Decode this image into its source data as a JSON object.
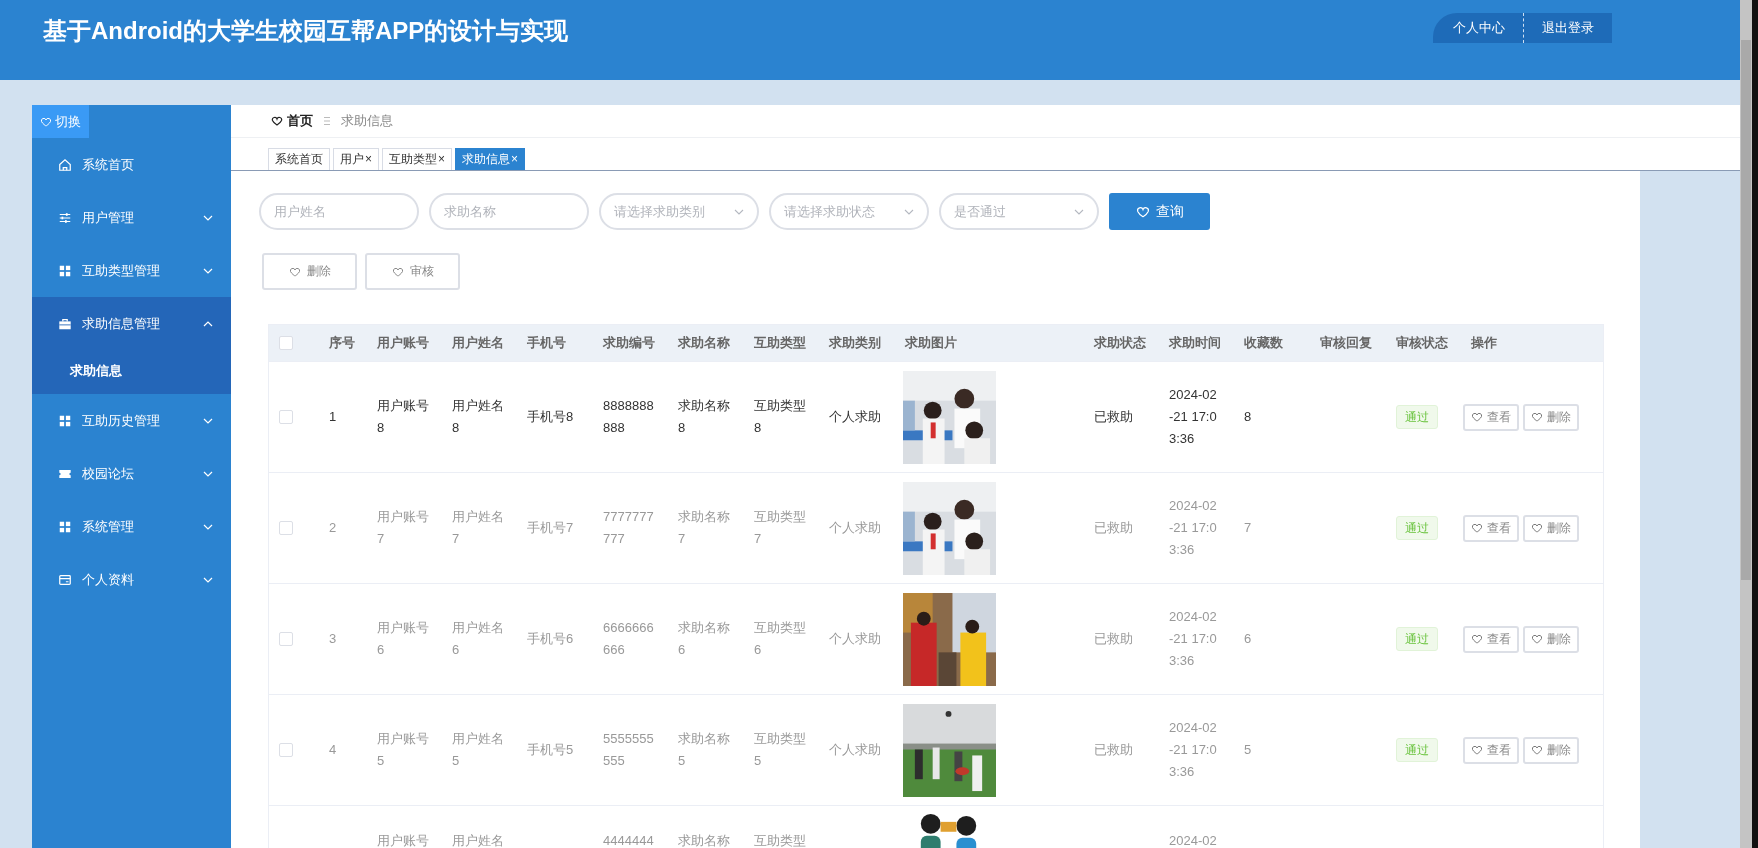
{
  "header": {
    "title": "基于Android的大学生校园互帮APP的设计与实现",
    "links": [
      {
        "label": "个人中心"
      },
      {
        "label": "退出登录"
      }
    ]
  },
  "sidebar": {
    "toggle": "切换",
    "items": [
      {
        "label": "系统首页",
        "collapsible": false,
        "expanded": false
      },
      {
        "label": "用户管理",
        "collapsible": true,
        "expanded": false
      },
      {
        "label": "互助类型管理",
        "collapsible": true,
        "expanded": false
      },
      {
        "label": "求助信息管理",
        "collapsible": true,
        "expanded": true,
        "children": [
          {
            "label": "求助信息",
            "selected": true
          }
        ]
      },
      {
        "label": "互助历史管理",
        "collapsible": true,
        "expanded": false
      },
      {
        "label": "校园论坛",
        "collapsible": true,
        "expanded": false
      },
      {
        "label": "系统管理",
        "collapsible": true,
        "expanded": false
      },
      {
        "label": "个人资料",
        "collapsible": true,
        "expanded": false
      }
    ]
  },
  "breadcrumb": {
    "home": "首页",
    "current": "求助信息"
  },
  "tabs": [
    {
      "label": "系统首页",
      "selected": false
    },
    {
      "label": "用户",
      "close": "×",
      "selected": false
    },
    {
      "label": "互助类型",
      "close": "×",
      "selected": false
    },
    {
      "label": "求助信息",
      "close": "×",
      "selected": true
    }
  ],
  "filters": [
    {
      "kind": "text",
      "placeholder": "用户姓名"
    },
    {
      "kind": "text",
      "placeholder": "求助名称"
    },
    {
      "kind": "select",
      "placeholder": "请选择求助类别"
    },
    {
      "kind": "select",
      "placeholder": "请选择求助状态"
    },
    {
      "kind": "select",
      "placeholder": "是否通过"
    }
  ],
  "search_button": "查询",
  "actions": [
    {
      "label": "删除"
    },
    {
      "label": "审核"
    }
  ],
  "table": {
    "select_all": {
      "checked": false
    },
    "columns": [
      "序号",
      "用户账号",
      "用户姓名",
      "手机号",
      "求助编号",
      "求助名称",
      "互助类型",
      "求助类别",
      "求助图片",
      "求助状态",
      "求助时间",
      "收藏数",
      "审核回复",
      "审核状态",
      "操作"
    ],
    "rows": [
      {
        "checked": false,
        "highlighted": true,
        "index": "1",
        "account": "用户账号8",
        "name": "用户姓名8",
        "phone": "手机号8",
        "code": "8888888888",
        "title": "求助名称8",
        "type": "互助类型8",
        "category": "个人求助",
        "status": "已救助",
        "time": "2024-02-21 17:03:36",
        "favorites": "8",
        "audit": "通过",
        "buttons": [
          "查看",
          "删除"
        ]
      },
      {
        "checked": false,
        "highlighted": false,
        "index": "2",
        "account": "用户账号7",
        "name": "用户姓名7",
        "phone": "手机号7",
        "code": "7777777777",
        "title": "求助名称7",
        "type": "互助类型7",
        "category": "个人求助",
        "status": "已救助",
        "time": "2024-02-21 17:03:36",
        "favorites": "7",
        "audit": "通过",
        "buttons": [
          "查看",
          "删除"
        ]
      },
      {
        "checked": false,
        "highlighted": false,
        "index": "3",
        "account": "用户账号6",
        "name": "用户姓名6",
        "phone": "手机号6",
        "code": "6666666666",
        "title": "求助名称6",
        "type": "互助类型6",
        "category": "个人求助",
        "status": "已救助",
        "time": "2024-02-21 17:03:36",
        "favorites": "6",
        "audit": "通过",
        "buttons": [
          "查看",
          "删除"
        ]
      },
      {
        "checked": false,
        "highlighted": false,
        "index": "4",
        "account": "用户账号5",
        "name": "用户姓名5",
        "phone": "手机号5",
        "code": "5555555555",
        "title": "求助名称5",
        "type": "互助类型5",
        "category": "个人求助",
        "status": "已救助",
        "time": "2024-02-21 17:03:36",
        "favorites": "5",
        "audit": "通过",
        "buttons": [
          "查看",
          "删除"
        ]
      },
      {
        "highlighted": false,
        "account": "用户账号",
        "name": "用户姓名",
        "code": "4444444",
        "title": "求助名称",
        "type": "互助类型",
        "time": "2024-02"
      }
    ]
  }
}
